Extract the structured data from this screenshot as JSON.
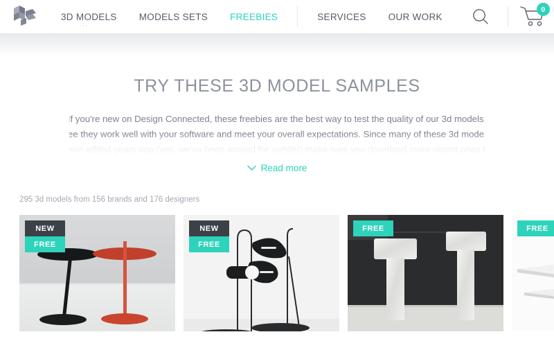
{
  "colors": {
    "accent": "#2ed3bb",
    "badge_dark": "#3c4148",
    "nav_text": "#565b66",
    "muted_text": "#7c828d"
  },
  "header": {
    "logo_name": "design-connected-logo",
    "nav": [
      {
        "label": "3D MODELS",
        "active": false,
        "has_dots": true,
        "dots": "···"
      },
      {
        "label": "MODELS SETS",
        "active": false,
        "has_dots": false
      },
      {
        "label": "FREEBIES",
        "active": true,
        "has_dots": false
      },
      {
        "label": "SERVICES",
        "active": false,
        "has_dots": false
      },
      {
        "label": "OUR WORK",
        "active": false,
        "has_dots": false
      }
    ],
    "search_icon": "search-icon",
    "cart_icon": "shopping-cart-icon",
    "cart_count": "0"
  },
  "hero": {
    "title": "TRY THESE 3D MODEL SAMPLES",
    "body": "If you're new on Design Connected, these freebies are the best way to test the quality of our 3d models, see they work well with your software and meet your overall expectations. Since many of these 3d models were added years ago (yes, we've been around for awhile!) make sure you download more recent ones to become",
    "read_more_label": "Read more",
    "read_more_icon": "chevron-down-icon"
  },
  "results": {
    "count_text": "295 3d models from 156 brands and 176 designers"
  },
  "cards": [
    {
      "name": "card-side-tables",
      "thumb": "side-tables-black-red",
      "badges": [
        {
          "label": "NEW",
          "style": "new"
        },
        {
          "label": "FREE",
          "style": "free"
        }
      ]
    },
    {
      "name": "card-table-lamps",
      "thumb": "black-sculptural-table-lamps",
      "badges": [
        {
          "label": "NEW",
          "style": "new"
        },
        {
          "label": "FREE",
          "style": "free"
        }
      ]
    },
    {
      "name": "card-marble-floor-lamps",
      "thumb": "white-marble-floor-lamps",
      "badges": [
        {
          "label": "FREE",
          "style": "free"
        }
      ]
    },
    {
      "name": "card-white-shelf",
      "thumb": "white-shelf-table",
      "badges": [
        {
          "label": "FREE",
          "style": "free"
        }
      ]
    }
  ]
}
